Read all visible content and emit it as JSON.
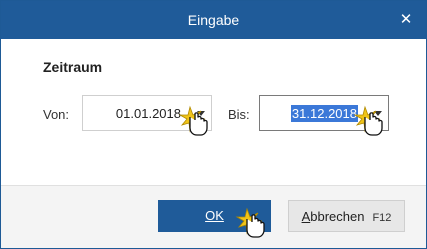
{
  "dialog": {
    "title": "Eingabe",
    "close_glyph": "✕"
  },
  "section": {
    "title": "Zeitraum"
  },
  "fields": {
    "von": {
      "label": "Von:",
      "value": "01.01.2018"
    },
    "bis": {
      "label": "Bis:",
      "value": "31.12.2018"
    }
  },
  "buttons": {
    "ok": {
      "label": "OK"
    },
    "cancel": {
      "label_accel": "A",
      "label_rest": "bbrechen",
      "shortcut": "F12"
    }
  },
  "colors": {
    "titlebar": "#1f5b99",
    "ok_button": "#1f5b99",
    "selection": "#3b78d8",
    "click_burst": "#f0c419"
  },
  "icons": {
    "close": "close-icon",
    "dropdown": "chevron-down-icon",
    "pointer": "hand-pointer-icon"
  }
}
